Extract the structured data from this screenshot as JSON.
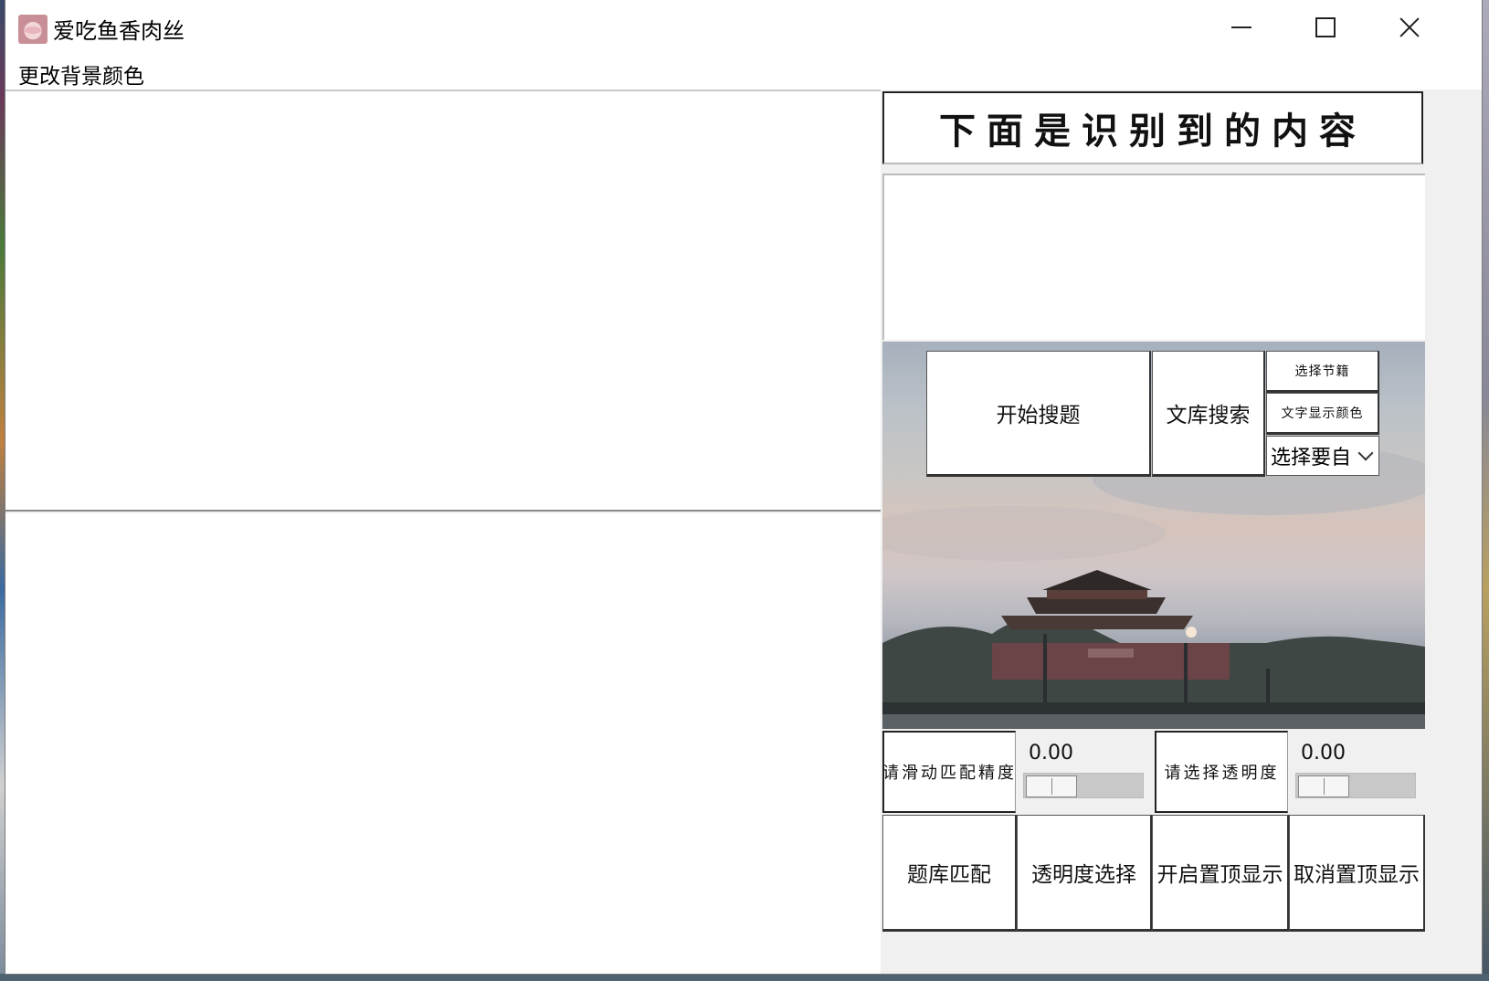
{
  "window": {
    "title": "爱吃鱼香肉丝"
  },
  "menu": {
    "items": [
      "更改背景颜色"
    ]
  },
  "recognition": {
    "header": "下面是识别到的内容",
    "result_text": ""
  },
  "buttons": {
    "start_search": "开始搜题",
    "library_search": "文库搜索",
    "choose_section": "选择节籍",
    "text_color": "文字显示颜色",
    "bank_match": "题库匹配",
    "transparency_select": "透明度选择",
    "enable_topmost": "开启置顶显示",
    "cancel_topmost": "取消置顶显示"
  },
  "select": {
    "value": "选择要自"
  },
  "sliders": [
    {
      "label": "请滑动匹配精度",
      "value": "0.00",
      "fraction": 0.0
    },
    {
      "label": "请选择透明度",
      "value": "0.00",
      "fraction": 0.0
    }
  ]
}
